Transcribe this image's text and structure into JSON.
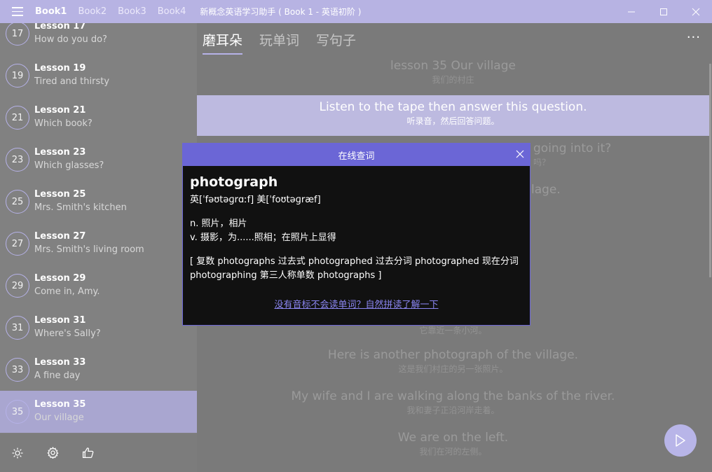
{
  "titlebar": {
    "books": [
      "Book1",
      "Book2",
      "Book3",
      "Book4"
    ],
    "active_book": "Book1",
    "app_title": "新概念英语学习助手 ( Book 1 - 英语初阶 )"
  },
  "sidebar": {
    "lessons": [
      {
        "num": "17",
        "title": "Lesson 17",
        "sub": "How do you do?"
      },
      {
        "num": "19",
        "title": "Lesson 19",
        "sub": "Tired and thirsty"
      },
      {
        "num": "21",
        "title": "Lesson 21",
        "sub": "Which book?"
      },
      {
        "num": "23",
        "title": "Lesson 23",
        "sub": "Which glasses?"
      },
      {
        "num": "25",
        "title": "Lesson 25",
        "sub": "Mrs. Smith's kitchen"
      },
      {
        "num": "27",
        "title": "Lesson 27",
        "sub": "Mrs. Smith's living room"
      },
      {
        "num": "29",
        "title": "Lesson 29",
        "sub": "Come in, Amy."
      },
      {
        "num": "31",
        "title": "Lesson 31",
        "sub": "Where's Sally?"
      },
      {
        "num": "33",
        "title": "Lesson 33",
        "sub": "A fine day"
      },
      {
        "num": "35",
        "title": "Lesson 35",
        "sub": "Our village"
      }
    ],
    "selected_lesson": "35"
  },
  "main": {
    "tabs": [
      "磨耳朵",
      "玩单词",
      "写句子"
    ],
    "active_tab": "磨耳朵",
    "more": "···",
    "sentences": [
      {
        "en": "lesson 35  Our village",
        "zh": "我们的村庄"
      },
      {
        "en": "Listen to the tape then answer this question.",
        "zh": "听录音，然后回答问题。"
      },
      {
        "en": "going into it?",
        "zh": "吗？"
      },
      {
        "en": "lage.",
        "zh": ""
      },
      {
        "en": "",
        "zh": "它靠近一条小河。"
      },
      {
        "en": "Here is another photograph of the village.",
        "zh": "这是我们村庄的另一张照片。"
      },
      {
        "en": "My wife and I are walking along the banks of the river.",
        "zh": "我和妻子正沿河岸走着。"
      },
      {
        "en": "We are on the left.",
        "zh": "我们在河的左侧。"
      }
    ]
  },
  "dialog": {
    "title": "在线查词",
    "word": "photograph",
    "phonetic": "英[ˈfəʊtəɡrɑːf]  美[ˈfoʊtəɡræf]",
    "def1": "n. 照片，相片",
    "def2": "v. 摄影，为......照相；在照片上显得",
    "forms": "[ 复数 photographs 过去式 photographed 过去分词 photographed 现在分词 photographing 第三人称单数 photographs ]",
    "link": "没有音标不会读单词？自然拼读了解一下"
  },
  "colors": {
    "accent": "#6b66d6",
    "titlebar": "#b7b3e3",
    "selected": "#a9a6d0"
  }
}
